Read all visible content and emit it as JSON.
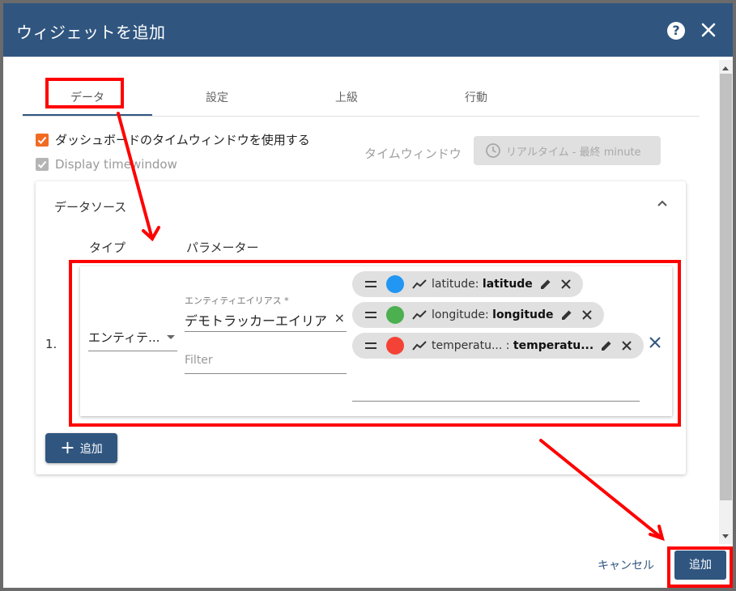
{
  "dialog": {
    "title": "ウィジェットを追加",
    "help_icon": "question-circle-icon",
    "help_label": "?",
    "close_icon": "close-icon"
  },
  "tabs": [
    {
      "label": "データ",
      "active": true
    },
    {
      "label": "設定",
      "active": false
    },
    {
      "label": "上級",
      "active": false
    },
    {
      "label": "行動",
      "active": false
    }
  ],
  "options": {
    "use_dashboard_timewindow": {
      "label": "ダッシュボードのタイムウィンドウを使用する",
      "checked": true
    },
    "display_timewindow": {
      "label": "Display timewindow",
      "checked": true,
      "disabled": true
    },
    "timewindow_label": "タイムウィンドウ",
    "timewindow_button": "リアルタイム - 最終 minute"
  },
  "datasources": {
    "title": "データソース",
    "col_type": "タイプ",
    "col_params": "パラメーター",
    "rows": [
      {
        "index": "1.",
        "type": "エンティテ...",
        "alias_label": "エンティティエイリアス *",
        "alias_value": "デモトラッカーエイリア",
        "alias_clear": "×",
        "filter_placeholder": "Filter",
        "keys": [
          {
            "key": "latitude",
            "label": "latitude",
            "color": "#2196f3"
          },
          {
            "key": "longitude",
            "label": "longitude",
            "color": "#4caf50"
          },
          {
            "key": "temperatu...",
            "label": "temperatu...",
            "color": "#f44336"
          }
        ]
      }
    ],
    "add_label": "追加"
  },
  "footer": {
    "cancel_label": "キャンセル",
    "submit_label": "追加"
  },
  "colors": {
    "primary": "#305680",
    "accent_orange": "#f26b23",
    "annotation_red": "#ff0000"
  }
}
